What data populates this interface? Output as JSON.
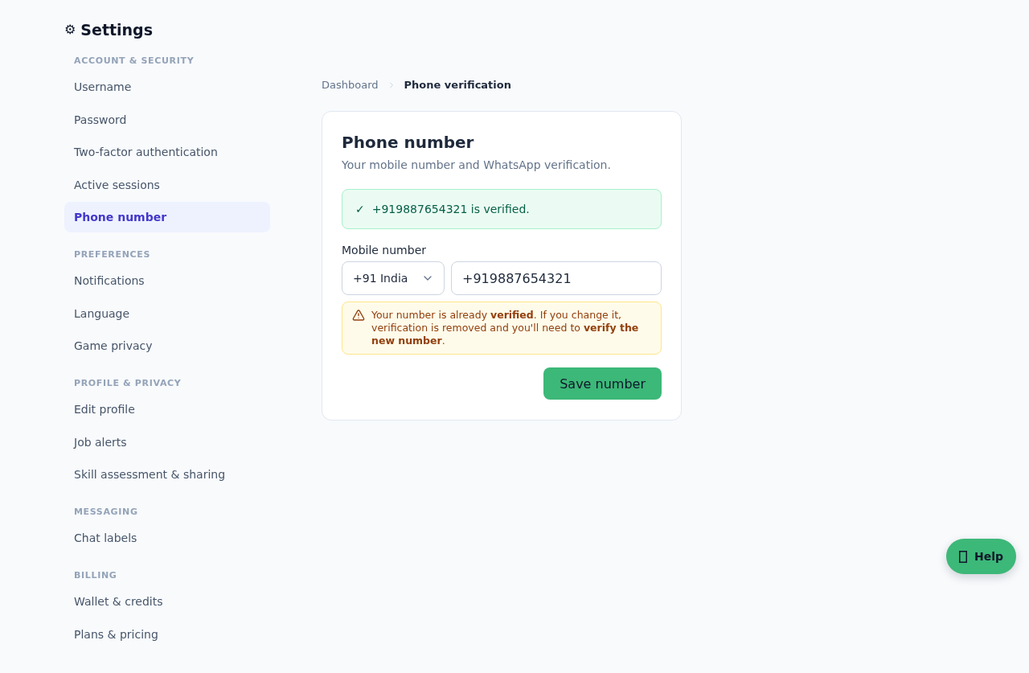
{
  "sidebar": {
    "title_icon": "⚙",
    "title": "Settings",
    "sections": [
      {
        "heading": "ACCOUNT & SECURITY",
        "items": [
          {
            "label": "Username",
            "selected": false
          },
          {
            "label": "Password",
            "selected": false
          },
          {
            "label": "Two-factor authentication",
            "selected": false
          },
          {
            "label": "Active sessions",
            "selected": false
          },
          {
            "label": "Phone number",
            "selected": true
          }
        ]
      },
      {
        "heading": "PREFERENCES",
        "items": [
          {
            "label": "Notifications",
            "selected": false
          },
          {
            "label": "Language",
            "selected": false
          },
          {
            "label": "Game privacy",
            "selected": false
          }
        ]
      },
      {
        "heading": "PROFILE & PRIVACY",
        "items": [
          {
            "label": "Edit profile",
            "selected": false
          },
          {
            "label": "Job alerts",
            "selected": false
          },
          {
            "label": "Skill assessment & sharing",
            "selected": false
          }
        ]
      },
      {
        "heading": "MESSAGING",
        "items": [
          {
            "label": "Chat labels",
            "selected": false
          }
        ]
      },
      {
        "heading": "BILLING",
        "items": [
          {
            "label": "Wallet & credits",
            "selected": false
          },
          {
            "label": "Plans & pricing",
            "selected": false
          }
        ]
      }
    ]
  },
  "breadcrumb": {
    "parent": "Dashboard",
    "current": "Phone verification"
  },
  "card": {
    "title": "Phone number",
    "subtitle": "Your mobile number and WhatsApp verification.",
    "status": {
      "kind": "success",
      "icon": "✓",
      "text": "+919887654321 is verified."
    },
    "field": {
      "label": "Mobile number",
      "country": "+91 India",
      "value": "+919887654321"
    },
    "notice": {
      "kind": "warning",
      "text": "Your number is already **verified**. If you change it, verification is removed and you'll need to **verify the new number**."
    },
    "save_button": "Save number"
  },
  "help_button": {
    "label": "Help"
  }
}
